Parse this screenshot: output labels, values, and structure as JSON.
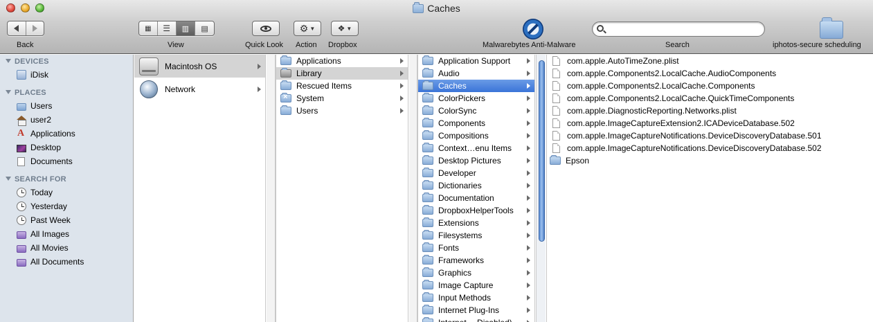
{
  "window": {
    "title": "Caches"
  },
  "toolbar": {
    "back_label": "Back",
    "view_label": "View",
    "quicklook_label": "Quick Look",
    "action_label": "Action",
    "dropbox_label": "Dropbox",
    "malwarebytes_label": "Malwarebytes Anti-Malware",
    "search_label": "Search",
    "search_placeholder": "",
    "iphotos_label": "iphotos-secure scheduling",
    "active_view": "columns"
  },
  "sidebar": {
    "devices_header": "DEVICES",
    "devices": [
      {
        "label": "iDisk",
        "icon": "idisk-icon"
      }
    ],
    "places_header": "PLACES",
    "places": [
      {
        "label": "Users",
        "icon": "folder-icon"
      },
      {
        "label": "user2",
        "icon": "home-icon"
      },
      {
        "label": "Applications",
        "icon": "applications-icon"
      },
      {
        "label": "Desktop",
        "icon": "desktop-icon"
      },
      {
        "label": "Documents",
        "icon": "document-icon"
      }
    ],
    "search_header": "SEARCH FOR",
    "search_for": [
      {
        "label": "Today",
        "icon": "clock-icon"
      },
      {
        "label": "Yesterday",
        "icon": "clock-icon"
      },
      {
        "label": "Past Week",
        "icon": "clock-icon"
      },
      {
        "label": "All Images",
        "icon": "smart-folder-icon"
      },
      {
        "label": "All Movies",
        "icon": "smart-folder-icon"
      },
      {
        "label": "All Documents",
        "icon": "smart-folder-icon"
      }
    ]
  },
  "columns": {
    "col1": [
      {
        "label": "Macintosh OS",
        "selected": true
      },
      {
        "label": "Network",
        "selected": false
      }
    ],
    "col2": [
      {
        "label": "Applications"
      },
      {
        "label": "Library",
        "selected": true
      },
      {
        "label": "Rescued Items"
      },
      {
        "label": "System"
      },
      {
        "label": "Users"
      }
    ],
    "col3": [
      "Application Support",
      "Audio",
      "Caches",
      "ColorPickers",
      "ColorSync",
      "Components",
      "Compositions",
      "Context…enu Items",
      "Desktop Pictures",
      "Developer",
      "Dictionaries",
      "Documentation",
      "DropboxHelperTools",
      "Extensions",
      "Filesystems",
      "Fonts",
      "Frameworks",
      "Graphics",
      "Image Capture",
      "Input Methods",
      "Internet Plug-Ins",
      "Internet …Disabled)"
    ],
    "col3_selected": "Caches",
    "col4": [
      {
        "label": "com.apple.AutoTimeZone.plist",
        "kind": "file"
      },
      {
        "label": "com.apple.Components2.LocalCache.AudioComponents",
        "kind": "file"
      },
      {
        "label": "com.apple.Components2.LocalCache.Components",
        "kind": "file"
      },
      {
        "label": "com.apple.Components2.LocalCache.QuickTimeComponents",
        "kind": "file"
      },
      {
        "label": "com.apple.DiagnosticReporting.Networks.plist",
        "kind": "file"
      },
      {
        "label": "com.apple.ImageCaptureExtension2.ICADeviceDatabase.502",
        "kind": "file"
      },
      {
        "label": "com.apple.ImageCaptureNotifications.DeviceDiscoveryDatabase.501",
        "kind": "file"
      },
      {
        "label": "com.apple.ImageCaptureNotifications.DeviceDiscoveryDatabase.502",
        "kind": "file"
      },
      {
        "label": "Epson",
        "kind": "folder"
      }
    ]
  },
  "colors": {
    "selection_blue": "#3a74d8",
    "selection_gray": "#d4d4d4",
    "sidebar_bg": "#dde4ec"
  }
}
